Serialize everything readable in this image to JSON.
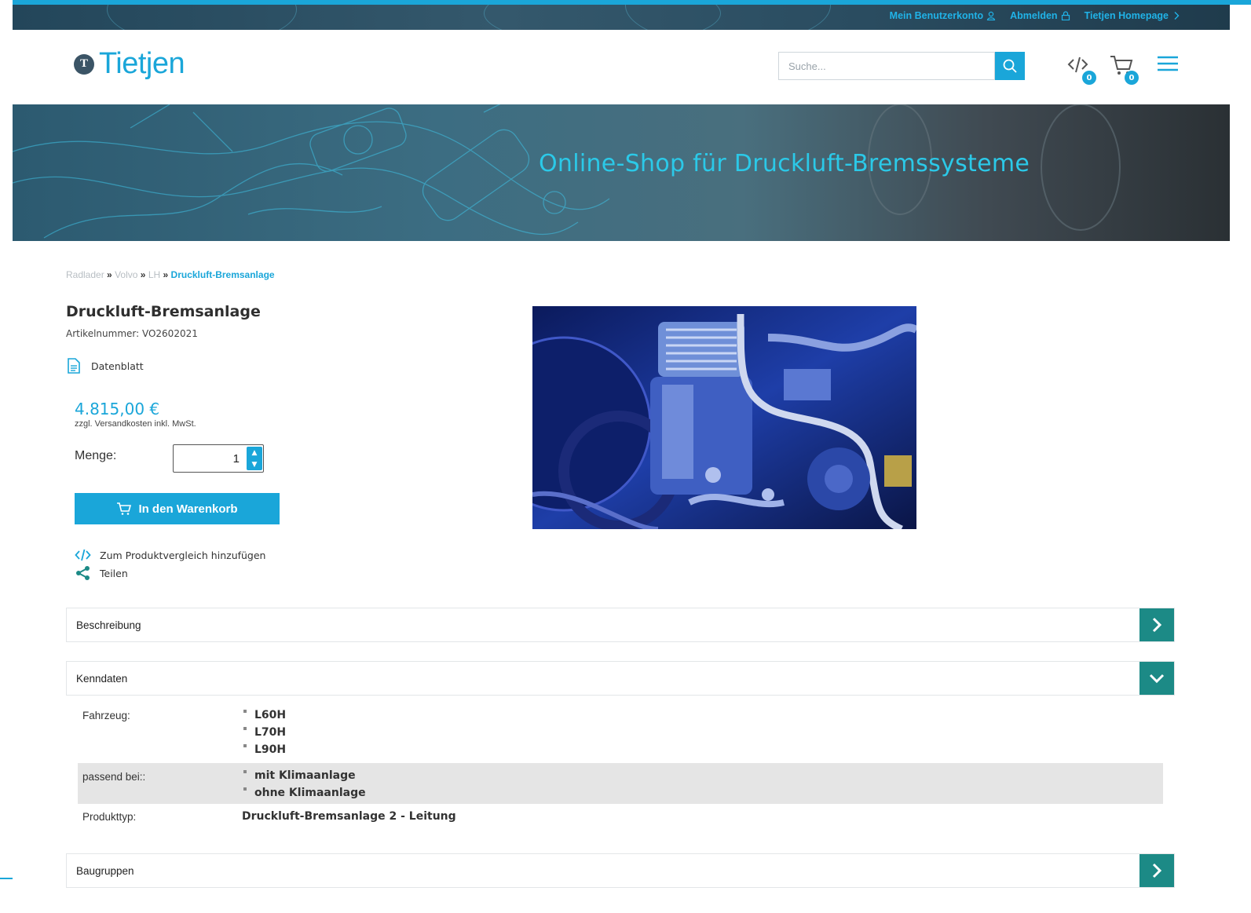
{
  "topbar": {
    "links": [
      {
        "label": "Mein Benutzerkonto",
        "icon": "user-icon"
      },
      {
        "label": "Abmelden",
        "icon": "lock-icon"
      },
      {
        "label": "Tietjen Homepage",
        "icon": "chevron-right-icon"
      }
    ]
  },
  "header": {
    "logo_text": "Tietjen",
    "logo_mark": "T",
    "search_placeholder": "Suche...",
    "compare_count": "0",
    "cart_count": "0"
  },
  "hero": {
    "tagline": "Online-Shop für Druckluft-Bremssysteme"
  },
  "breadcrumb": {
    "items": [
      "Radlader",
      "Volvo",
      "LH"
    ],
    "separator": "»",
    "current": "Druckluft-Bremsanlage"
  },
  "product": {
    "title": "Druckluft-Bremsanlage",
    "article_number": "Artikelnummer: VO2602021",
    "datasheet_label": "Datenblatt",
    "price": "4.815,00 €",
    "price_note": "zzgl. Versandkosten inkl. MwSt.",
    "quantity_label": "Menge:",
    "quantity_value": "1",
    "add_to_cart_label": "In den Warenkorb",
    "compare_label": "Zum Produktvergleich hinzufügen",
    "share_label": "Teilen"
  },
  "accordion": {
    "description_label": "Beschreibung",
    "specs_label": "Kenndaten",
    "assemblies_label": "Baugruppen"
  },
  "specs": {
    "vehicle_key": "Fahrzeug:",
    "vehicle_values": [
      "L60H",
      "L70H",
      "L90H"
    ],
    "fits_key": "passend bei::",
    "fits_values": [
      "mit Klimaanlage",
      "ohne Klimaanlage"
    ],
    "type_key": "Produkttyp:",
    "type_value": "Druckluft-Bremsanlage 2 - Leitung"
  },
  "colors": {
    "accent": "#1aa6d9",
    "toggle": "#1c8a86",
    "spec_highlight": "#e5e5e5"
  }
}
